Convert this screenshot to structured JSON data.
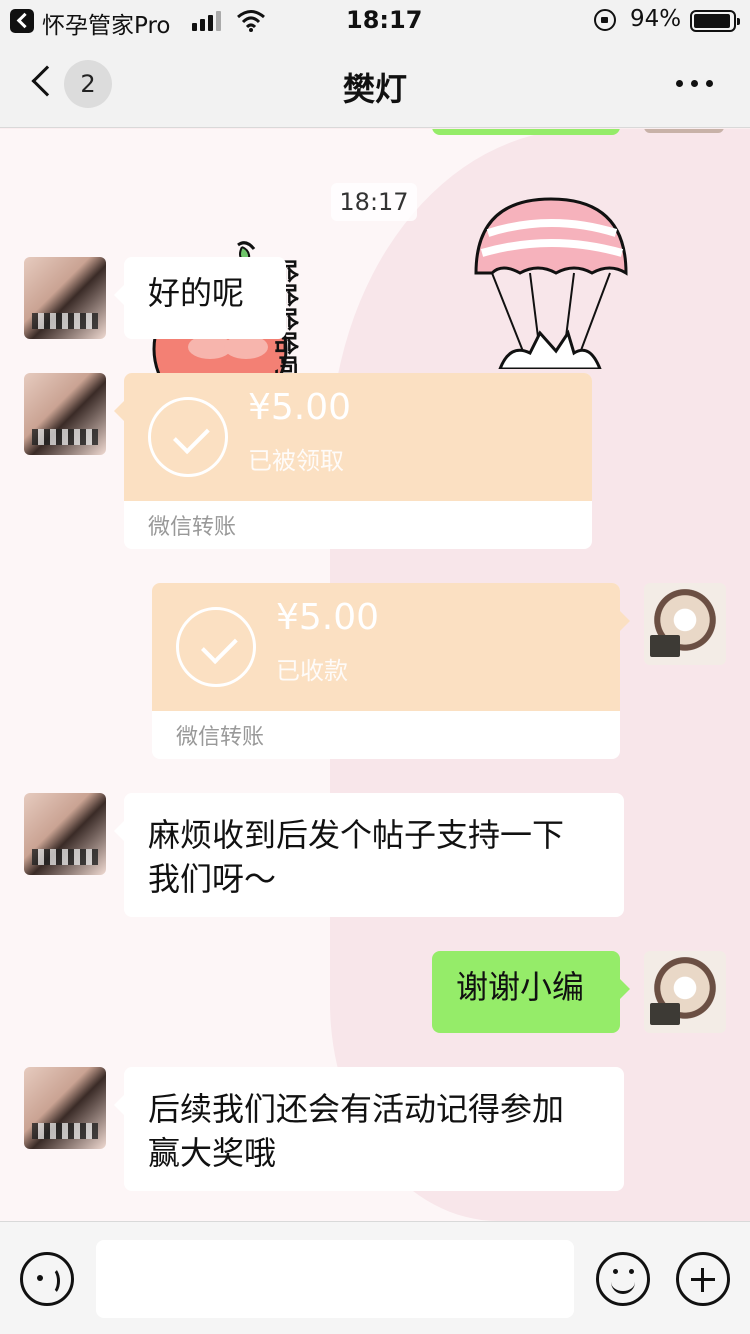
{
  "status_bar": {
    "app_name": "怀孕管家Pro",
    "time": "18:17",
    "battery": "94%"
  },
  "nav": {
    "unread_count": "2",
    "title": "樊灯"
  },
  "chat": {
    "timestamp": "18:17",
    "messages": [
      {
        "sender": "other",
        "type": "text",
        "text": "好的呢"
      },
      {
        "sender": "other",
        "type": "transfer",
        "amount": "¥5.00",
        "status": "已被领取",
        "footer": "微信转账"
      },
      {
        "sender": "me",
        "type": "transfer",
        "amount": "¥5.00",
        "status": "已收款",
        "footer": "微信转账"
      },
      {
        "sender": "other",
        "type": "text",
        "line1": "麻烦收到后发个帖子支持一下",
        "line2": "我们呀～"
      },
      {
        "sender": "me",
        "type": "text",
        "text": "谢谢小编"
      },
      {
        "sender": "other",
        "type": "text",
        "line1": "后续我们还会有活动记得参加",
        "line2": "赢大奖哦"
      }
    ],
    "sticker_apple_text": "哈哈哈哈呵"
  },
  "colors": {
    "bubble_green": "#95ec69",
    "transfer_orange": "#fbe0c2"
  },
  "input": {
    "placeholder": ""
  }
}
